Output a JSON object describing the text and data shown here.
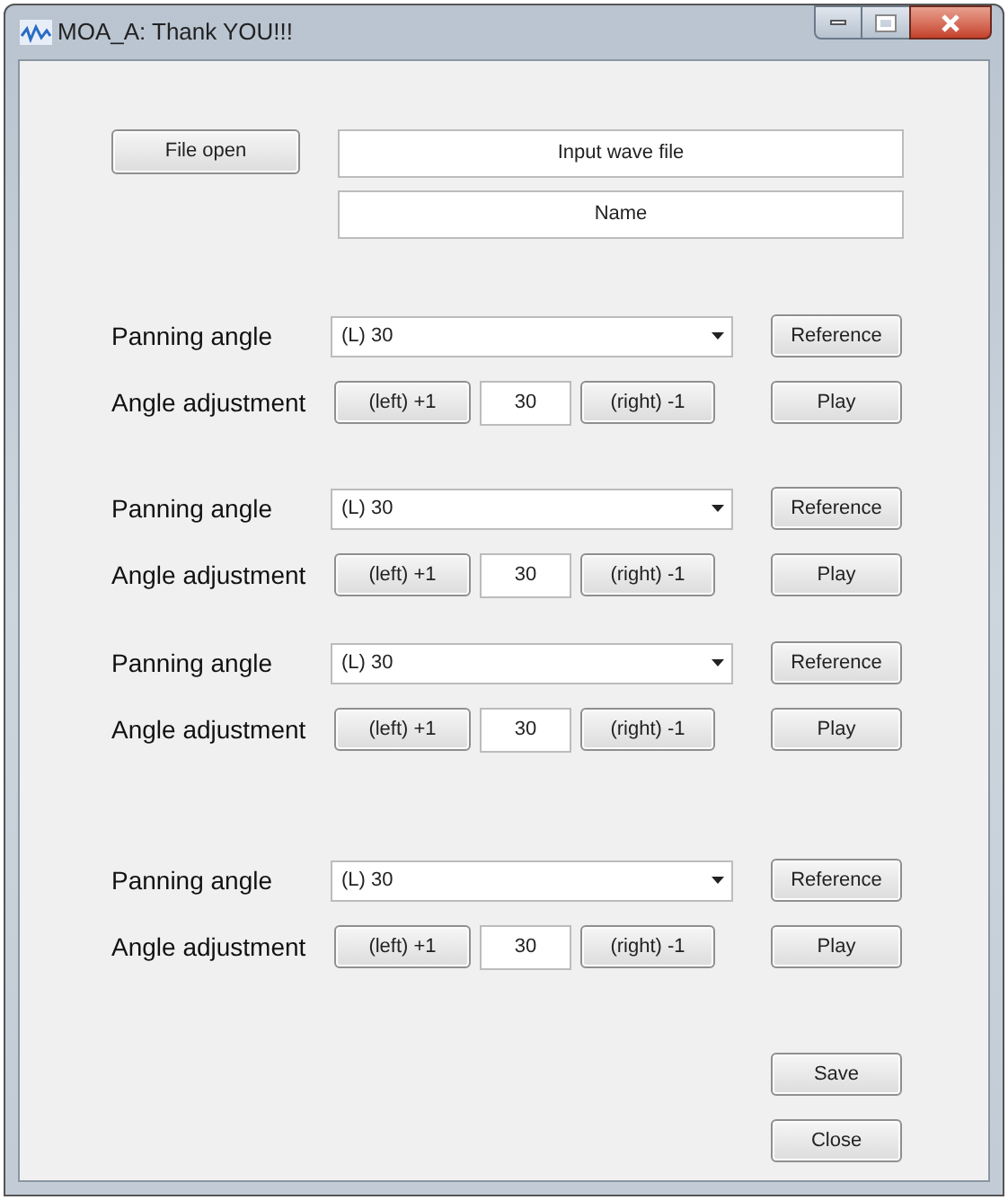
{
  "window": {
    "title": "MOA_A: Thank YOU!!!"
  },
  "file": {
    "button": "File open",
    "input": "Input wave file",
    "name": "Name"
  },
  "groups": [
    {
      "panning_label": "Panning angle",
      "panning_value": "(L) 30",
      "reference": "Reference",
      "adjust_label": "Angle adjustment",
      "left": "(left) +1",
      "angle": "30",
      "right": "(right) -1",
      "play": "Play"
    },
    {
      "panning_label": "Panning angle",
      "panning_value": "(L) 30",
      "reference": "Reference",
      "adjust_label": "Angle adjustment",
      "left": "(left) +1",
      "angle": "30",
      "right": "(right) -1",
      "play": "Play"
    },
    {
      "panning_label": "Panning angle",
      "panning_value": "(L) 30",
      "reference": "Reference",
      "adjust_label": "Angle adjustment",
      "left": "(left) +1",
      "angle": "30",
      "right": "(right) -1",
      "play": "Play"
    },
    {
      "panning_label": "Panning angle",
      "panning_value": "(L) 30",
      "reference": "Reference",
      "adjust_label": "Angle adjustment",
      "left": "(left) +1",
      "angle": "30",
      "right": "(right) -1",
      "play": "Play"
    }
  ],
  "buttons": [
    "Save",
    "Close"
  ]
}
